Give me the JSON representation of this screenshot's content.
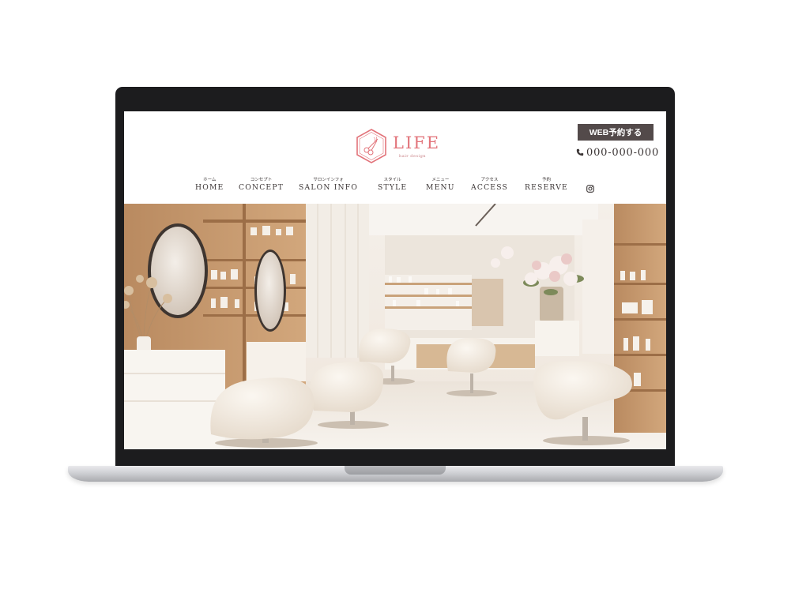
{
  "site": {
    "logo": {
      "name": "LIFE",
      "tagline": "hair design",
      "icon": "scissors-hexagon-icon"
    },
    "web_reserve_button": "WEB予約する",
    "phone": {
      "icon": "phone-icon",
      "number": "000-000-000"
    },
    "nav": [
      {
        "kana": "ホーム",
        "label": "HOME"
      },
      {
        "kana": "コンセプト",
        "label": "CONCEPT"
      },
      {
        "kana": "サロンインフォ",
        "label": "SALON INFO"
      },
      {
        "kana": "スタイル",
        "label": "STYLE"
      },
      {
        "kana": "メニュー",
        "label": "MENU"
      },
      {
        "kana": "アクセス",
        "label": "ACCESS"
      },
      {
        "kana": "予約",
        "label": "RESERVE"
      }
    ],
    "social_icon": "instagram-icon",
    "hero_image": "salon-interior-photo"
  },
  "colors": {
    "brand_pink": "#e2737a",
    "button_dark": "#534a4a",
    "text_dark": "#3b3535",
    "laptop_bezel": "#1c1c1e"
  }
}
